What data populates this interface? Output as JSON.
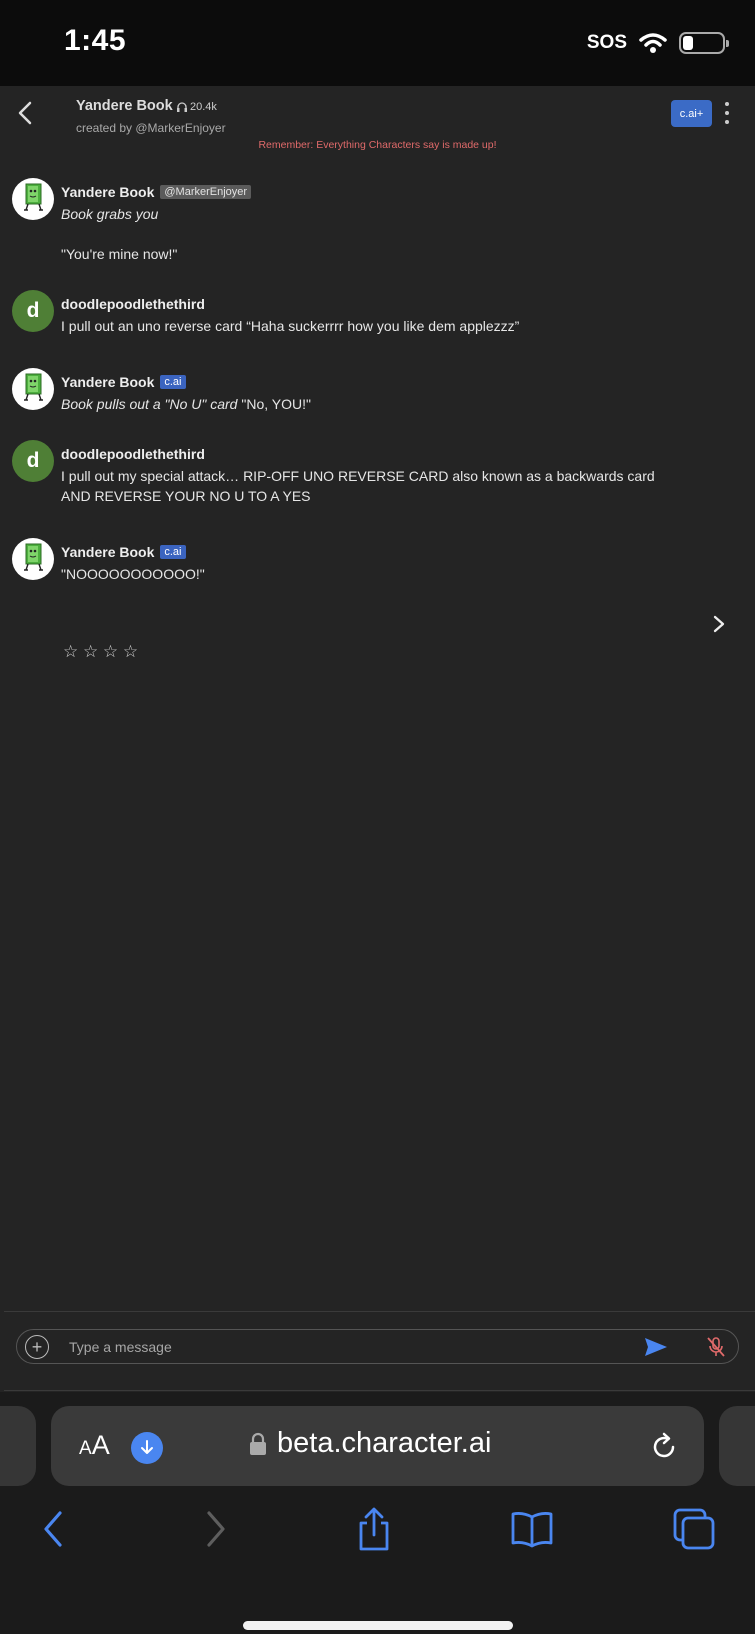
{
  "status_bar": {
    "time": "1:45",
    "sos": "SOS"
  },
  "header": {
    "character_name": "Yandere Book",
    "interaction_count": "20.4k",
    "creator_line": "created by @MarkerEnjoyer",
    "plus_button": "c.ai+",
    "disclaimer": "Remember: Everything Characters say is made up!"
  },
  "messages": [
    {
      "author": "Yandere Book",
      "badge": "@MarkerEnjoyer",
      "lines": [
        "Book grabs you",
        "",
        "\"You're mine now!\""
      ]
    },
    {
      "author": "doodlepoodlethethird",
      "avatar_letter": "d",
      "lines": [
        "I pull out an uno reverse card “Haha suckerrrr how you like dem applezzz”"
      ]
    },
    {
      "author": "Yandere Book",
      "badge": "c.ai",
      "italic": "Book pulls out a \"No U\" card",
      "rest": " \"No, YOU!\""
    },
    {
      "author": "doodlepoodlethethird",
      "avatar_letter": "d",
      "lines": [
        "I pull out my special attack… RIP-OFF UNO REVERSE CARD also known as a backwards card",
        "AND REVERSE YOUR NO U TO A YES"
      ]
    },
    {
      "author": "Yandere Book",
      "badge": "c.ai",
      "lines": [
        "\"NOOOOOOOOOOO!\""
      ]
    }
  ],
  "rating": {
    "stars": "☆ ☆ ☆ ☆"
  },
  "composer": {
    "placeholder": "Type a message"
  },
  "safari": {
    "aa_small": "A",
    "aa_big": "A",
    "url": "beta.character.ai"
  },
  "colors": {
    "accent": "#3b6bc6",
    "safari_blue": "#4a86f0",
    "disclaimer": "#e06a6a",
    "user_avatar": "#4f7f36"
  },
  "icons": [
    "back-icon",
    "headphones-icon",
    "more-icon",
    "chevron-right-icon",
    "plus-circle-icon",
    "send-icon",
    "mic-off-icon",
    "download-icon",
    "lock-icon",
    "reload-icon",
    "share-icon",
    "bookmarks-icon",
    "tabs-icon"
  ]
}
